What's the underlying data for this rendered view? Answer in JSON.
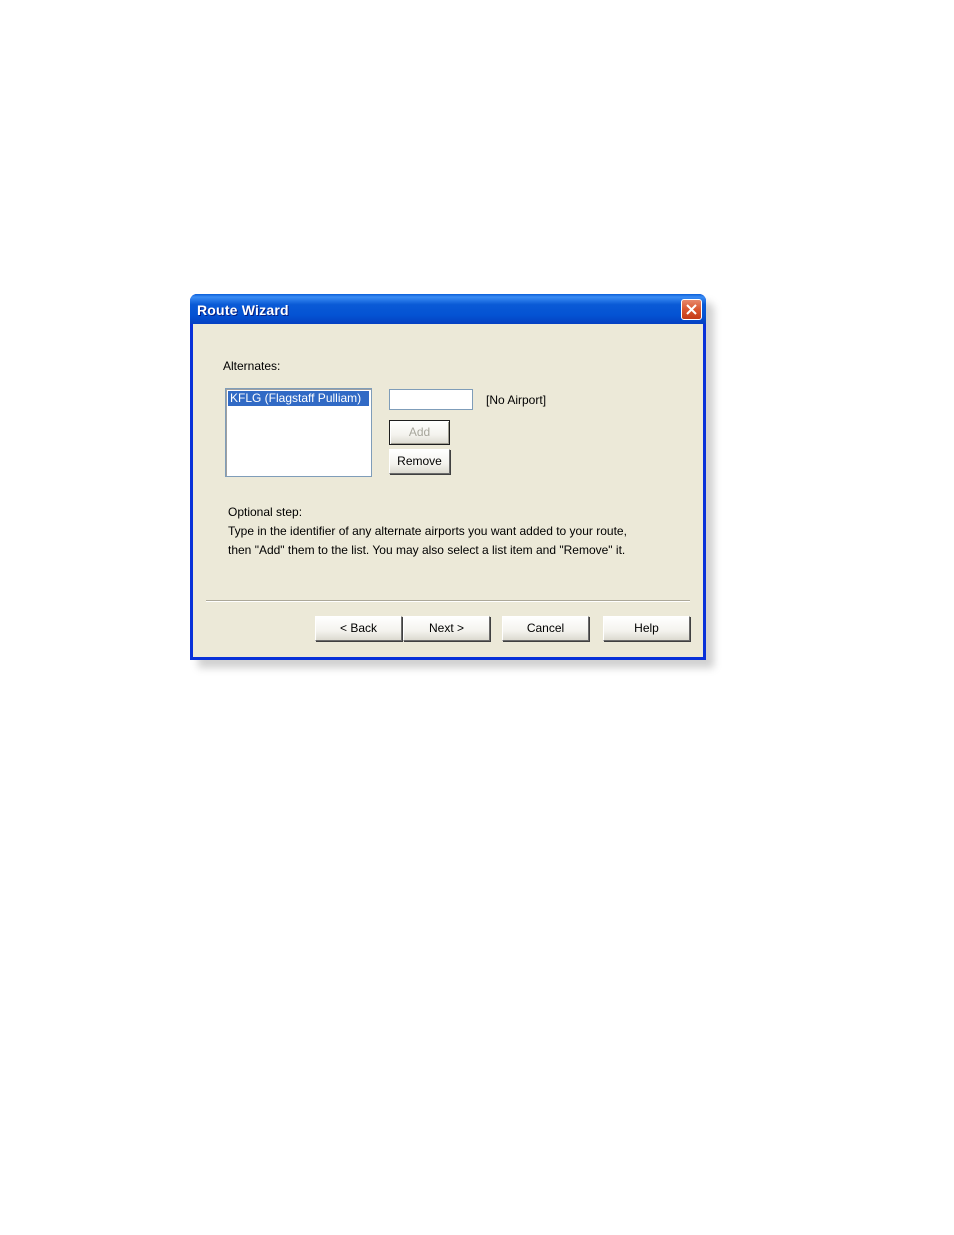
{
  "window": {
    "title": "Route Wizard",
    "close_icon": "close-x-icon"
  },
  "alternates": {
    "label": "Alternates:",
    "items": [
      "KFLG (Flagstaff Pulliam)"
    ],
    "selected_index": 0
  },
  "airport_entry": {
    "value": "",
    "status": "[No Airport]"
  },
  "actions": {
    "add_label": "Add",
    "remove_label": "Remove"
  },
  "help_text": {
    "line1": "Optional step:",
    "line2": "Type in the identifier of any alternate airports you want added to your route,",
    "line3": "then \"Add\" them to the list.  You may also select a list item and \"Remove\" it."
  },
  "footer": {
    "back_label": "< Back",
    "next_label": "Next >",
    "cancel_label": "Cancel",
    "help_label": "Help"
  },
  "colors": {
    "titlebar": "#0453d3",
    "dialog_face": "#ece9d8",
    "selection": "#316ac5",
    "close_button": "#d9562f"
  }
}
